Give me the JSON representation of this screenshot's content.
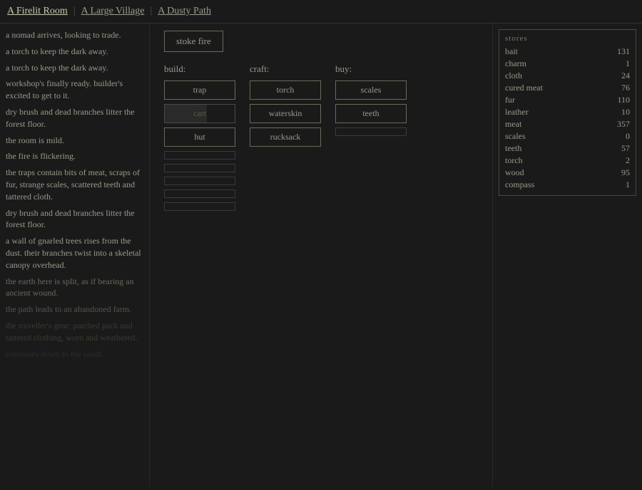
{
  "nav": {
    "tabs": [
      {
        "label": "A Firelit Room",
        "active": true
      },
      {
        "label": "A Large Village",
        "active": false
      },
      {
        "label": "A Dusty Path",
        "active": false
      }
    ]
  },
  "stoke": {
    "label": "stoke fire"
  },
  "log": {
    "entries": [
      {
        "text": "a nomad arrives, looking to trade.",
        "fade": 0
      },
      {
        "text": "a torch to keep the dark away.",
        "fade": 0
      },
      {
        "text": "a torch to keep the dark away.",
        "fade": 0
      },
      {
        "text": "workshop's finally ready. builder's excited to get to it.",
        "fade": 0
      },
      {
        "text": "dry brush and dead branches litter the forest floor.",
        "fade": 0
      },
      {
        "text": "the room is mild.",
        "fade": 0
      },
      {
        "text": "the fire is flickering.",
        "fade": 0
      },
      {
        "text": "the traps contain bits of meat, scraps of fur, strange scales, scattered teeth and tattered cloth.",
        "fade": 0
      },
      {
        "text": "dry brush and dead branches litter the forest floor.",
        "fade": 0
      },
      {
        "text": "a wall of gnarled trees rises from the dust. their branches twist into a skeletal canopy overhead.",
        "fade": 0
      },
      {
        "text": "the earth here is split, as if bearing an ancient wound.",
        "fade": 1
      },
      {
        "text": "the path leads to an abandoned farm.",
        "fade": 2
      },
      {
        "text": "the traveller's gear: patched pack and tattered clothing, worn and weathered.",
        "fade": 3
      },
      {
        "text": "continues down to the south.",
        "fade": 4
      }
    ]
  },
  "build": {
    "label": "build:",
    "buttons": [
      {
        "label": "trap",
        "state": "normal"
      },
      {
        "label": "cart",
        "state": "cooldown"
      },
      {
        "label": "hut",
        "state": "normal"
      },
      {
        "label": "",
        "state": "disabled"
      },
      {
        "label": "",
        "state": "disabled"
      },
      {
        "label": "",
        "state": "disabled"
      },
      {
        "label": "",
        "state": "disabled"
      },
      {
        "label": "",
        "state": "disabled"
      }
    ]
  },
  "craft": {
    "label": "craft:",
    "buttons": [
      {
        "label": "torch",
        "state": "normal"
      },
      {
        "label": "waterskin",
        "state": "normal"
      },
      {
        "label": "rucksack",
        "state": "normal"
      }
    ]
  },
  "buy": {
    "label": "buy:",
    "buttons": [
      {
        "label": "scales",
        "state": "normal"
      },
      {
        "label": "teeth",
        "state": "normal"
      },
      {
        "label": "",
        "state": "disabled"
      }
    ]
  },
  "stores": {
    "title": "stores",
    "items": [
      {
        "name": "bait",
        "value": "131"
      },
      {
        "name": "charm",
        "value": "1"
      },
      {
        "name": "cloth",
        "value": "24"
      },
      {
        "name": "cured meat",
        "value": "76"
      },
      {
        "name": "fur",
        "value": "110"
      },
      {
        "name": "leather",
        "value": "10"
      },
      {
        "name": "meat",
        "value": "357"
      },
      {
        "name": "scales",
        "value": "0"
      },
      {
        "name": "teeth",
        "value": "57"
      },
      {
        "name": "torch",
        "value": "2"
      },
      {
        "name": "wood",
        "value": "95"
      },
      {
        "name": "compass",
        "value": "1"
      }
    ]
  }
}
